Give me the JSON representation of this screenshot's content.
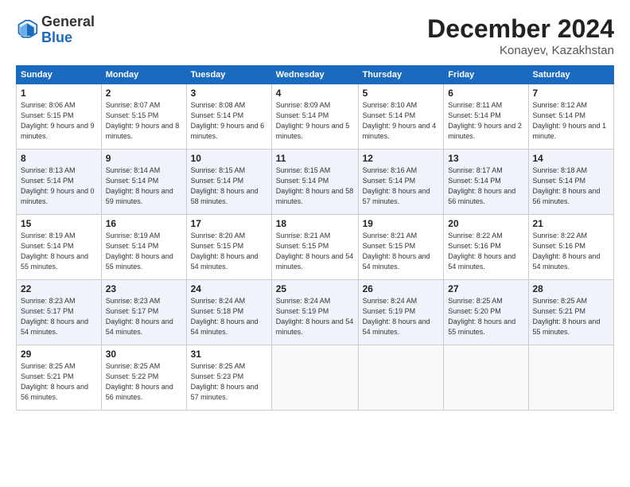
{
  "header": {
    "logo_general": "General",
    "logo_blue": "Blue",
    "month_title": "December 2024",
    "location": "Konayev, Kazakhstan"
  },
  "weekdays": [
    "Sunday",
    "Monday",
    "Tuesday",
    "Wednesday",
    "Thursday",
    "Friday",
    "Saturday"
  ],
  "weeks": [
    [
      {
        "day": "1",
        "sunrise": "8:06 AM",
        "sunset": "5:15 PM",
        "daylight": "9 hours and 9 minutes."
      },
      {
        "day": "2",
        "sunrise": "8:07 AM",
        "sunset": "5:15 PM",
        "daylight": "9 hours and 8 minutes."
      },
      {
        "day": "3",
        "sunrise": "8:08 AM",
        "sunset": "5:14 PM",
        "daylight": "9 hours and 6 minutes."
      },
      {
        "day": "4",
        "sunrise": "8:09 AM",
        "sunset": "5:14 PM",
        "daylight": "9 hours and 5 minutes."
      },
      {
        "day": "5",
        "sunrise": "8:10 AM",
        "sunset": "5:14 PM",
        "daylight": "9 hours and 4 minutes."
      },
      {
        "day": "6",
        "sunrise": "8:11 AM",
        "sunset": "5:14 PM",
        "daylight": "9 hours and 2 minutes."
      },
      {
        "day": "7",
        "sunrise": "8:12 AM",
        "sunset": "5:14 PM",
        "daylight": "9 hours and 1 minute."
      }
    ],
    [
      {
        "day": "8",
        "sunrise": "8:13 AM",
        "sunset": "5:14 PM",
        "daylight": "9 hours and 0 minutes."
      },
      {
        "day": "9",
        "sunrise": "8:14 AM",
        "sunset": "5:14 PM",
        "daylight": "8 hours and 59 minutes."
      },
      {
        "day": "10",
        "sunrise": "8:15 AM",
        "sunset": "5:14 PM",
        "daylight": "8 hours and 58 minutes."
      },
      {
        "day": "11",
        "sunrise": "8:15 AM",
        "sunset": "5:14 PM",
        "daylight": "8 hours and 58 minutes."
      },
      {
        "day": "12",
        "sunrise": "8:16 AM",
        "sunset": "5:14 PM",
        "daylight": "8 hours and 57 minutes."
      },
      {
        "day": "13",
        "sunrise": "8:17 AM",
        "sunset": "5:14 PM",
        "daylight": "8 hours and 56 minutes."
      },
      {
        "day": "14",
        "sunrise": "8:18 AM",
        "sunset": "5:14 PM",
        "daylight": "8 hours and 56 minutes."
      }
    ],
    [
      {
        "day": "15",
        "sunrise": "8:19 AM",
        "sunset": "5:14 PM",
        "daylight": "8 hours and 55 minutes."
      },
      {
        "day": "16",
        "sunrise": "8:19 AM",
        "sunset": "5:14 PM",
        "daylight": "8 hours and 55 minutes."
      },
      {
        "day": "17",
        "sunrise": "8:20 AM",
        "sunset": "5:15 PM",
        "daylight": "8 hours and 54 minutes."
      },
      {
        "day": "18",
        "sunrise": "8:21 AM",
        "sunset": "5:15 PM",
        "daylight": "8 hours and 54 minutes."
      },
      {
        "day": "19",
        "sunrise": "8:21 AM",
        "sunset": "5:15 PM",
        "daylight": "8 hours and 54 minutes."
      },
      {
        "day": "20",
        "sunrise": "8:22 AM",
        "sunset": "5:16 PM",
        "daylight": "8 hours and 54 minutes."
      },
      {
        "day": "21",
        "sunrise": "8:22 AM",
        "sunset": "5:16 PM",
        "daylight": "8 hours and 54 minutes."
      }
    ],
    [
      {
        "day": "22",
        "sunrise": "8:23 AM",
        "sunset": "5:17 PM",
        "daylight": "8 hours and 54 minutes."
      },
      {
        "day": "23",
        "sunrise": "8:23 AM",
        "sunset": "5:17 PM",
        "daylight": "8 hours and 54 minutes."
      },
      {
        "day": "24",
        "sunrise": "8:24 AM",
        "sunset": "5:18 PM",
        "daylight": "8 hours and 54 minutes."
      },
      {
        "day": "25",
        "sunrise": "8:24 AM",
        "sunset": "5:19 PM",
        "daylight": "8 hours and 54 minutes."
      },
      {
        "day": "26",
        "sunrise": "8:24 AM",
        "sunset": "5:19 PM",
        "daylight": "8 hours and 54 minutes."
      },
      {
        "day": "27",
        "sunrise": "8:25 AM",
        "sunset": "5:20 PM",
        "daylight": "8 hours and 55 minutes."
      },
      {
        "day": "28",
        "sunrise": "8:25 AM",
        "sunset": "5:21 PM",
        "daylight": "8 hours and 55 minutes."
      }
    ],
    [
      {
        "day": "29",
        "sunrise": "8:25 AM",
        "sunset": "5:21 PM",
        "daylight": "8 hours and 56 minutes."
      },
      {
        "day": "30",
        "sunrise": "8:25 AM",
        "sunset": "5:22 PM",
        "daylight": "8 hours and 56 minutes."
      },
      {
        "day": "31",
        "sunrise": "8:25 AM",
        "sunset": "5:23 PM",
        "daylight": "8 hours and 57 minutes."
      },
      null,
      null,
      null,
      null
    ]
  ]
}
